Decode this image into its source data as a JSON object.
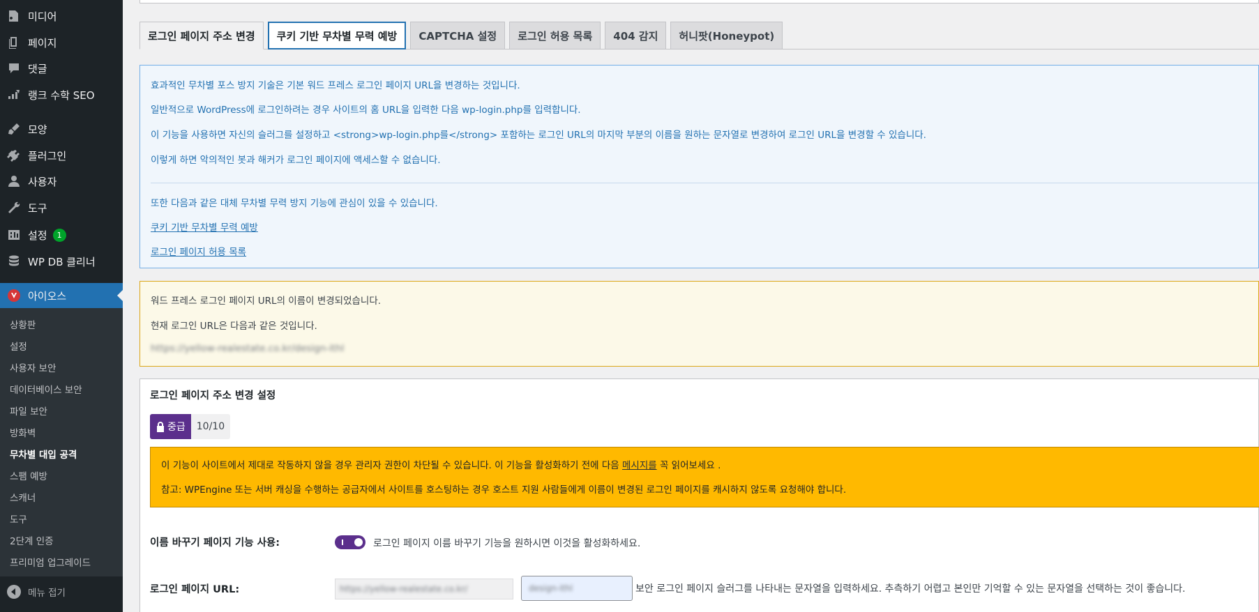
{
  "sidebar": {
    "items": [
      {
        "label": "미디어",
        "icon": "media-icon"
      },
      {
        "label": "페이지",
        "icon": "pages-icon"
      },
      {
        "label": "댓글",
        "icon": "comments-icon"
      },
      {
        "label": "랭크 수학 SEO",
        "icon": "rank-math-icon"
      },
      {
        "label": "모양",
        "icon": "appearance-icon"
      },
      {
        "label": "플러그인",
        "icon": "plugins-icon"
      },
      {
        "label": "사용자",
        "icon": "users-icon"
      },
      {
        "label": "도구",
        "icon": "tools-icon"
      },
      {
        "label": "설정",
        "icon": "settings-icon",
        "badge": "1"
      },
      {
        "label": "WP DB 클리너",
        "icon": "database-icon"
      }
    ],
    "active": {
      "label": "아이오스",
      "icon": "ithemes-icon"
    },
    "submenu": [
      "상황판",
      "설정",
      "사용자 보안",
      "데이터베이스 보안",
      "파일 보안",
      "방화벽",
      "무차별 대입 공격",
      "스팸 예방",
      "스캐너",
      "도구",
      "2단계 인증",
      "프리미엄 업그레이드"
    ],
    "collapse_label": "메뉴 접기"
  },
  "tabs": [
    "로그인 페이지 주소 변경",
    "쿠키 기반 무차별 무력 예방",
    "CAPTCHA 설정",
    "로그인 허용 목록",
    "404 감지",
    "허니팟(Honeypot)"
  ],
  "info": {
    "p1": "효과적인 무차별 포스 방지 기술은 기본 워드 프레스 로그인 페이지 URL을 변경하는 것입니다.",
    "p2": "일반적으로 WordPress에 로그인하려는 경우 사이트의 홈 URL을 입력한 다음 wp-login.php를 입력합니다.",
    "p3": "이 기능을 사용하면 자신의 슬러그를 설정하고 <strong>wp-login.php를</strong> 포함하는 로그인 URL의 마지막 부분의 이름을 원하는 문자열로 변경하여 로그인 URL을 변경할 수 있습니다.",
    "p4": "이렇게 하면 악의적인 봇과 해커가 로그인 페이지에 액세스할 수 없습니다.",
    "p5": "또한 다음과 같은 대체 무차별 무력 방지 기능에 관심이 있을 수 있습니다.",
    "link1": "쿠키 기반 무차별 무력 예방",
    "link2": "로그인 페이지 허용 목록"
  },
  "notice": {
    "p1": "워드 프레스 로그인 페이지 URL의 이름이 변경되었습니다.",
    "p2": "현재 로그인 URL은 다음과 같은 것입니다.",
    "url": "https://yellow-realestate.co.kr/design-ithl"
  },
  "settings": {
    "title": "로그인 페이지 주소 변경 설정",
    "grade_level": "중급",
    "grade_score": "10/10",
    "warning_p1_before": "이 기능이 사이트에서 제대로 작동하지 않을 경우 관리자 권한이 차단될 수 있습니다. 이 기능을 활성화하기 전에 다음 ",
    "warning_p1_link": "메시지를",
    "warning_p1_after": " 꼭 읽어보세요 .",
    "warning_p2": "참고: WPEngine 또는 서버 캐싱을 수행하는 공급자에서 사이트를 호스팅하는 경우 호스트 지원 사람들에게 이름이 변경된 로그인 페이지를 캐시하지 않도록 요청해야 합니다.",
    "enable_label": "이름 바꾸기 페이지 기능 사용:",
    "enable_desc": "로그인 페이지 이름 바꾸기 기능을 원하시면 이것을 활성화하세요.",
    "enabled": true,
    "url_label": "로그인 페이지 URL:",
    "url_prefix": "https://yellow-realestate.co.kr/",
    "url_slug": "design-ithl",
    "url_desc": "보안 로그인 페이지 슬러그를 나타내는 문자열을 입력하세요. 추측하기 어렵고 본인만 기억할 수 있는 문자열을 선택하는 것이 좋습니다."
  }
}
